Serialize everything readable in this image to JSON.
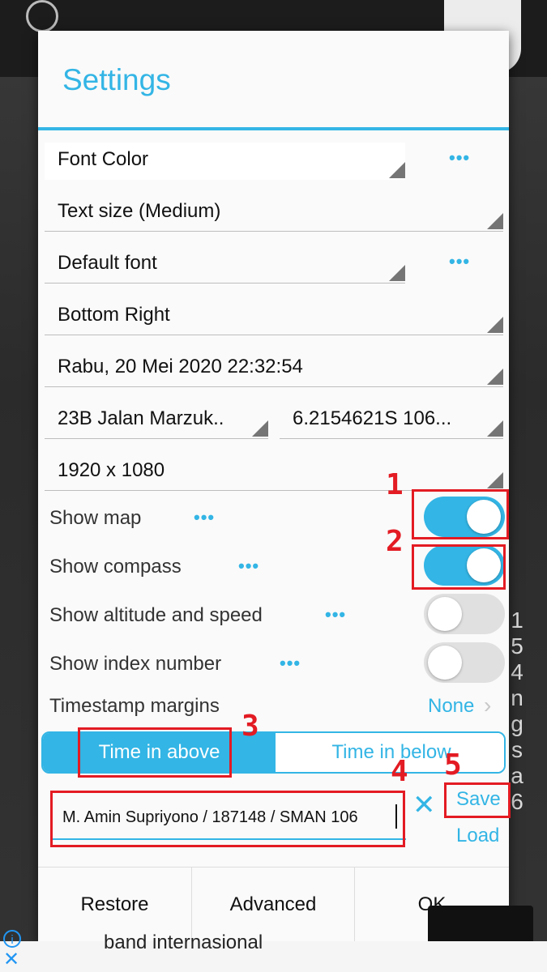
{
  "dialog": {
    "title": "Settings",
    "font_color": "Font Color",
    "text_size": "Text size (Medium)",
    "font": "Default font",
    "position": "Bottom Right",
    "date_time": "Rabu, 20 Mei 2020 22:32:54",
    "address": "23B Jalan Marzuk..",
    "coordinates": "6.2154621S 106...",
    "resolution": "1920 x 1080",
    "more_dots": "•••",
    "toggles": [
      {
        "label": "Show map",
        "on": true
      },
      {
        "label": "Show compass",
        "on": true
      },
      {
        "label": "Show altitude and speed",
        "on": false
      },
      {
        "label": "Show index number",
        "on": false
      }
    ],
    "margins_label": "Timestamp margins",
    "margins_value": "None",
    "time_above": "Time in above",
    "time_below": "Time in below",
    "custom_text": "M. Amin Supriyono / 187148 / SMAN 106",
    "save": "Save",
    "load": "Load",
    "footer": {
      "restore": "Restore",
      "advanced": "Advanced",
      "ok": "OK"
    }
  },
  "annotations": [
    "1",
    "2",
    "3",
    "4",
    "5"
  ],
  "ad": {
    "text": "band internasional"
  },
  "background": {
    "letters": [
      "1",
      "5",
      "4",
      "n",
      "g",
      "s",
      "a",
      "6"
    ]
  },
  "colors": {
    "accent": "#33b5e5",
    "annotation": "#e31b23"
  }
}
